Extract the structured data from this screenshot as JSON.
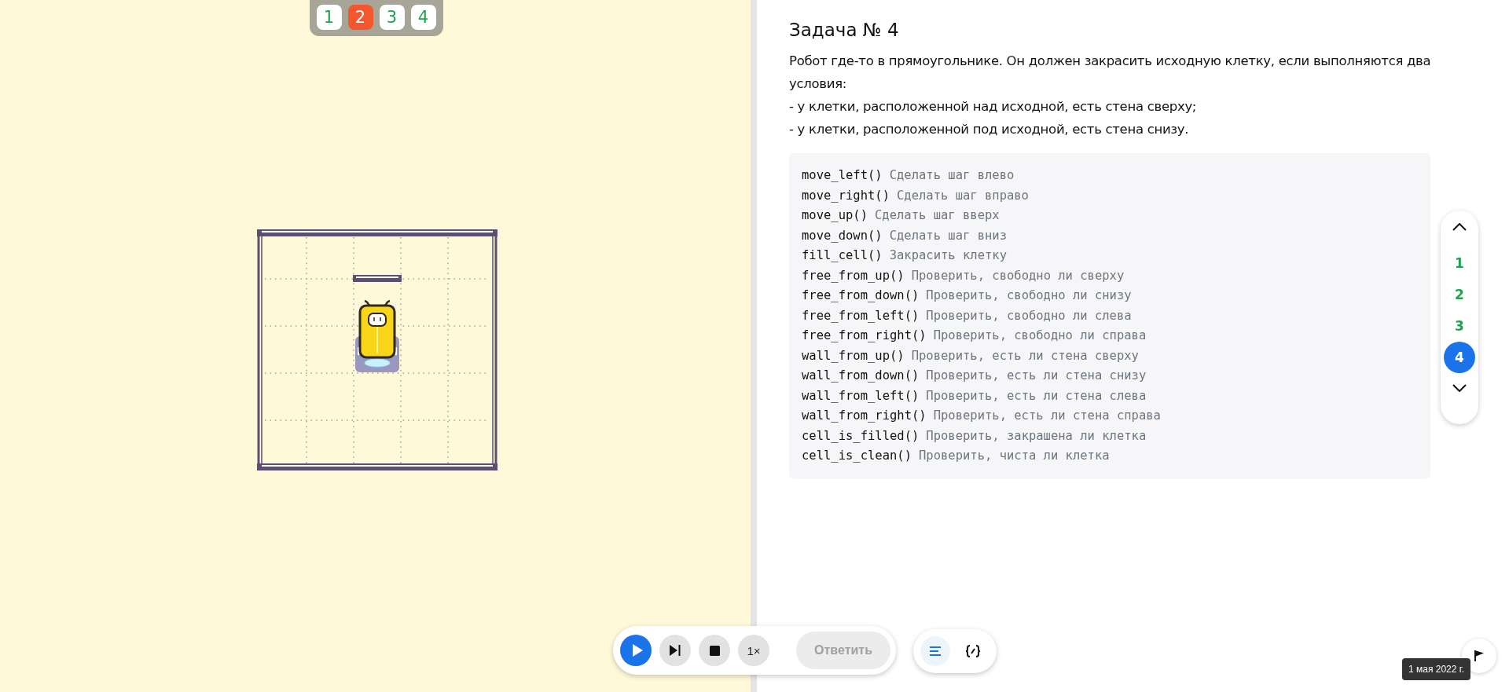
{
  "level_tabs": [
    {
      "label": "1",
      "selected": false
    },
    {
      "label": "2",
      "selected": true
    },
    {
      "label": "3",
      "selected": false
    },
    {
      "label": "4",
      "selected": false
    }
  ],
  "task": {
    "title": "Задача № 4",
    "lines": [
      "Робот где-то в прямоугольнике. Он должен закрасить исходную клетку, если выполняются два условия:",
      "- у клетки, расположенной над исходной, есть стена сверху;",
      "- у клетки, расположенной под исходной, есть стена снизу."
    ]
  },
  "commands": [
    {
      "name": "move_left()",
      "description": "Сделать шаг влево"
    },
    {
      "name": "move_right()",
      "description": "Сделать шаг вправо"
    },
    {
      "name": "move_up()",
      "description": "Сделать шаг вверх"
    },
    {
      "name": "move_down()",
      "description": "Сделать шаг вниз"
    },
    {
      "name": "fill_cell()",
      "description": "Закрасить клетку"
    },
    {
      "name": "free_from_up()",
      "description": "Проверить, свободно ли сверху"
    },
    {
      "name": "free_from_down()",
      "description": "Проверить, свободно ли снизу"
    },
    {
      "name": "free_from_left()",
      "description": "Проверить, свободно ли слева"
    },
    {
      "name": "free_from_right()",
      "description": "Проверить, свободно ли справа"
    },
    {
      "name": "wall_from_up()",
      "description": "Проверить, есть ли стена сверху"
    },
    {
      "name": "wall_from_down()",
      "description": "Проверить, есть ли стена снизу"
    },
    {
      "name": "wall_from_left()",
      "description": "Проверить, есть ли стена слева"
    },
    {
      "name": "wall_from_right()",
      "description": "Проверить, есть ли стена справа"
    },
    {
      "name": "cell_is_filled()",
      "description": "Проверить, закрашена ли клетка"
    },
    {
      "name": "cell_is_clean()",
      "description": "Проверить, чиста ли клетка"
    }
  ],
  "task_nav": [
    {
      "label": "1",
      "selected": false
    },
    {
      "label": "2",
      "selected": false
    },
    {
      "label": "3",
      "selected": false
    },
    {
      "label": "4",
      "selected": true
    }
  ],
  "player": {
    "speed": "1×",
    "answer": {
      "label": "Ответить",
      "disabled": true
    }
  },
  "view_modes": [
    {
      "kind": "text",
      "selected": true
    },
    {
      "kind": "code",
      "selected": false
    }
  ],
  "date_tooltip": "1 мая 2022 г."
}
